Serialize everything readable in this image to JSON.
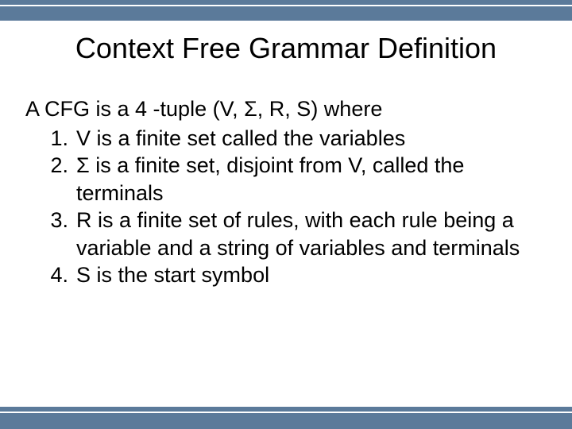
{
  "title": "Context Free Grammar Definition",
  "intro": "A CFG is a 4 -tuple (V, Σ, R, S) where",
  "items": {
    "0": "V is a finite set called the variables",
    "1": " Σ is a finite set, disjoint from V, called the terminals",
    "2": "R is a finite set of rules, with each rule being a variable and a string of variables and terminals",
    "3": "S is the start symbol"
  }
}
